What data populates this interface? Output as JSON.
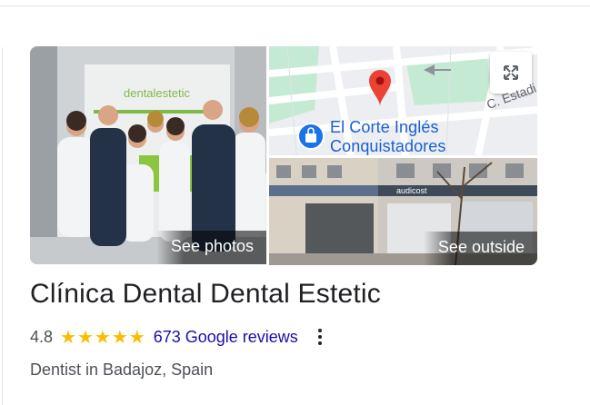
{
  "gallery": {
    "photos_label": "See photos",
    "outside_label": "See outside",
    "sign_text": "dentalestetic"
  },
  "map": {
    "place_line1": "El Corte Inglés",
    "place_line2": "Conquistadores",
    "street_label": "C. Estadi",
    "expand_icon": "expand-arrows-icon",
    "pin_color": "#ea4335",
    "poi_color": "#1a73e8"
  },
  "street_view": {
    "shop_sign": "audicost"
  },
  "business": {
    "name": "Clínica Dental Dental Estetic",
    "rating": "4.8",
    "stars": "★★★★★",
    "stars_value": 5,
    "reviews_link": "673 Google reviews",
    "category": "Dentist in Badajoz, Spain"
  },
  "colors": {
    "link": "#1a0dab",
    "star": "#fbbc04",
    "text": "#202124",
    "secondary": "#4d5156"
  }
}
